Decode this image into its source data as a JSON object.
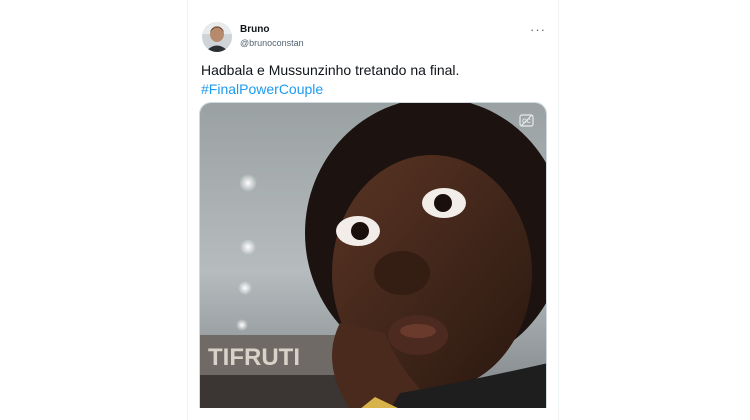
{
  "tweet": {
    "author_name": "Bruno",
    "author_handle": "@brunoconstan",
    "text": "Hadbala e Mussunzinho tretando na final.",
    "hashtag": "#FinalPowerCouple",
    "more_icon": "more-horizontal-icon",
    "avatar_icon": "avatar"
  },
  "media": {
    "type": "video",
    "caption_icon": "closed-captions-icon",
    "sign_text": "TIFRUTI"
  },
  "colors": {
    "accent": "#1d9bf0",
    "text": "#0f1419",
    "secondary": "#536471"
  }
}
